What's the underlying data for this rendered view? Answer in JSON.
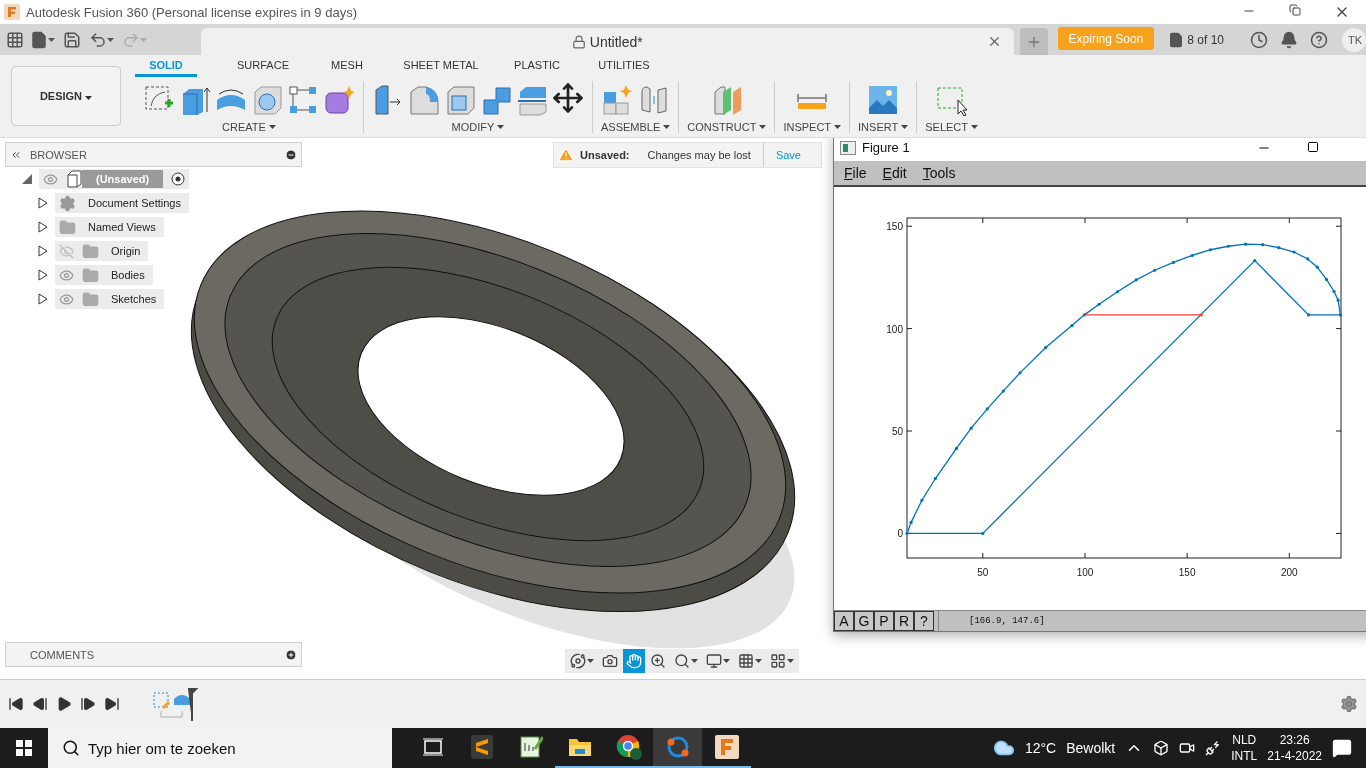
{
  "window": {
    "title": "Autodesk Fusion 360 (Personal license expires in 9 days)"
  },
  "quick_access": [
    {
      "kind": "file",
      "disabled": false
    },
    {
      "kind": "save",
      "disabled": false
    },
    {
      "kind": "undo",
      "disabled": false
    },
    {
      "kind": "redo",
      "disabled": true
    }
  ],
  "document_tab": {
    "title": "Untitled*"
  },
  "app_bar": {
    "expiring_button": "Expiring Soon",
    "job_count": "8 of 10",
    "user_initials": "TK"
  },
  "workspace_button": "DESIGN",
  "tabs": [
    {
      "label": "SOLID",
      "selected": true
    },
    {
      "label": "SURFACE",
      "selected": false
    },
    {
      "label": "MESH",
      "selected": false
    },
    {
      "label": "SHEET METAL",
      "selected": false
    },
    {
      "label": "PLASTIC",
      "selected": false
    },
    {
      "label": "UTILITIES",
      "selected": false
    }
  ],
  "tool_groups": [
    {
      "kind": "create",
      "label": "CREATE"
    },
    {
      "kind": "modify",
      "label": "MODIFY"
    },
    {
      "kind": "assemble",
      "label": "ASSEMBLE"
    },
    {
      "kind": "construct",
      "label": "CONSTRUCT"
    },
    {
      "kind": "inspect",
      "label": "INSPECT"
    },
    {
      "kind": "insert",
      "label": "INSERT"
    },
    {
      "kind": "select",
      "label": "SELECT"
    }
  ],
  "browser": {
    "title": "BROWSER",
    "items": [
      {
        "label": "(Unsaved)",
        "kind": "component",
        "visible": true,
        "expanded": true,
        "active": true,
        "children": [
          {
            "label": "Document Settings",
            "kind": "settings",
            "expanded": false
          },
          {
            "label": "Named Views",
            "kind": "folder",
            "expanded": false
          },
          {
            "label": "Origin",
            "kind": "folder",
            "visible": false,
            "expanded": false
          },
          {
            "label": "Bodies",
            "kind": "folder",
            "visible": true,
            "expanded": false
          },
          {
            "label": "Sketches",
            "kind": "folder",
            "visible": true,
            "expanded": false
          }
        ]
      }
    ]
  },
  "unsaved_banner": {
    "label": "Unsaved:",
    "message": "Changes may be lost",
    "action": "Save"
  },
  "comments": {
    "title": "COMMENTS"
  },
  "nav_toolbar": [
    {
      "kind": "orbit",
      "selected": false
    },
    {
      "kind": "look-at",
      "selected": false
    },
    {
      "kind": "pan",
      "selected": true
    },
    {
      "kind": "zoom",
      "selected": false
    },
    {
      "kind": "fit",
      "selected": false
    },
    {
      "kind": "display",
      "selected": false
    },
    {
      "kind": "grid",
      "selected": false
    },
    {
      "kind": "viewports",
      "selected": false
    }
  ],
  "figure": {
    "title": "Figure 1",
    "menu": [
      "File",
      "Edit",
      "Tools"
    ],
    "toolbar_buttons": [
      "A",
      "G",
      "P",
      "R",
      "?"
    ],
    "coordinates": "[166.9, 147.6]",
    "chart_data": {
      "type": "line",
      "xlim": [
        12.9,
        225.3
      ],
      "ylim": [
        -12,
        154
      ],
      "xticks": [
        50,
        100,
        150,
        200
      ],
      "yticks": [
        0,
        50,
        100,
        150
      ],
      "series": [
        {
          "color": "#0072bd",
          "x": [
            12.9,
            14.9,
            20.2,
            26.8,
            37.1,
            44.3,
            52.2,
            60,
            68.2,
            80.8,
            93.6,
            99.7,
            106.9,
            115.9,
            125.1,
            134.1,
            143.3,
            152.5,
            161.4,
            170.1,
            178.6,
            187,
            194.8,
            202.3,
            209,
            213.7,
            218.2,
            221.9,
            223.9,
            225
          ],
          "values": [
            0,
            5.4,
            16.2,
            26.8,
            41.5,
            51.4,
            60.8,
            69.5,
            78.4,
            90.8,
            101.5,
            106.7,
            111.9,
            118,
            123.8,
            128.5,
            132.3,
            135.7,
            138.5,
            140.2,
            141.2,
            141,
            139.5,
            137.4,
            134,
            130,
            124,
            118.1,
            113.9,
            106.7
          ]
        },
        {
          "color": "#0072bd",
          "x": [
            12.9,
            50,
            183.1,
            209.4,
            225
          ],
          "values": [
            0,
            0,
            133.2,
            106.7,
            106.7
          ]
        },
        {
          "color": "#ff3b3b",
          "x": [
            99.7,
            156.9
          ],
          "values": [
            106.7,
            106.7
          ]
        }
      ]
    }
  },
  "taskbar": {
    "search_placeholder": "Typ hier om te zoeken",
    "apps": [
      {
        "kind": "task-view",
        "running": false,
        "selected": false
      },
      {
        "kind": "sublime",
        "running": false,
        "selected": false
      },
      {
        "kind": "notepad",
        "running": false,
        "selected": false
      },
      {
        "kind": "explorer",
        "running": true,
        "selected": false
      },
      {
        "kind": "chrome",
        "running": true,
        "selected": false
      },
      {
        "kind": "orbit",
        "running": true,
        "selected": true
      },
      {
        "kind": "fusion",
        "running": true,
        "selected": false
      }
    ],
    "temperature": "12°C",
    "weather": "Bewolkt",
    "language": "NLD",
    "layout": "INTL",
    "time": "23:26",
    "date": "21-4-2022"
  }
}
